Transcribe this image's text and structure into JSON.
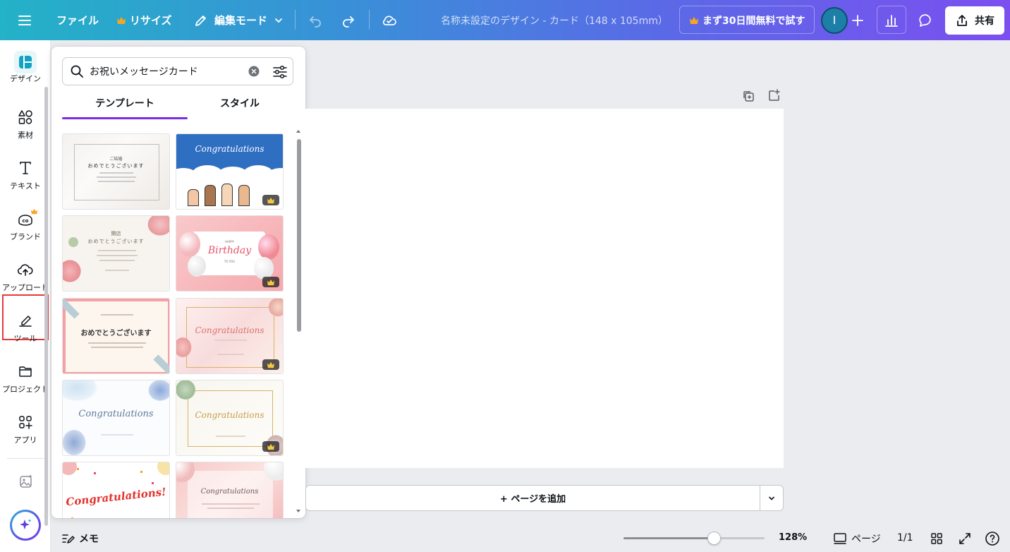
{
  "topbar": {
    "file": "ファイル",
    "resize": "リサイズ",
    "edit_mode": "編集モード",
    "doc_title": "名称未設定のデザイン - カード（148 x 105mm）",
    "trial": "まず30日間無料で試す",
    "avatar_initial": "I",
    "share": "共有"
  },
  "rail": {
    "design": "デザイン",
    "elements": "素材",
    "text": "テキスト",
    "brand": "ブランド",
    "uploads": "アップロード",
    "tools": "ツール",
    "projects": "プロジェクト",
    "apps": "アプリ"
  },
  "panel": {
    "search_value": "お祝いメッセージカード",
    "tab_templates": "テンプレート",
    "tab_styles": "スタイル",
    "cards": {
      "c1_line1": "ご結婚",
      "c1_line2": "おめでとうございます",
      "c2_title": "Congratulations",
      "c3_line1": "開店",
      "c3_line2": "おめでとうございます",
      "c4_line1": "HAPPY",
      "c4_line2": "Birthday",
      "c4_line3": "TO YOU",
      "c5_line1": "おめでとうございます",
      "c6_title": "Congratulations",
      "c7_title": "Congratulations",
      "c8_title": "Congratulations",
      "c9_title": "Congratulations!",
      "c10_title": "Congratulations"
    }
  },
  "canvas": {
    "add_page": "+ ページを追加"
  },
  "bottom": {
    "notes": "メモ",
    "zoom": "128%",
    "zoom_fraction": 0.64,
    "pages": "ページ",
    "page_count": "1/1"
  },
  "colors": {
    "accent": "#7d2ae8",
    "crown": "#f5a623",
    "highlight": "#e5383b"
  }
}
